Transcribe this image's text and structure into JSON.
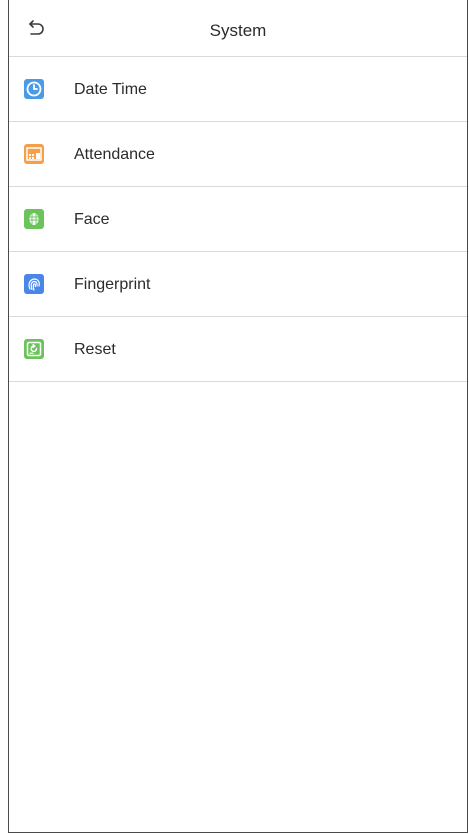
{
  "header": {
    "title": "System",
    "back_icon": "back-arrow-icon"
  },
  "menu": {
    "items": [
      {
        "label": "Date Time",
        "icon": "clock-icon",
        "color": "#4a9be6"
      },
      {
        "label": "Attendance",
        "icon": "attendance-icon",
        "color": "#f4a04a"
      },
      {
        "label": "Face",
        "icon": "face-icon",
        "color": "#6cc35c"
      },
      {
        "label": "Fingerprint",
        "icon": "fingerprint-icon",
        "color": "#4a86e8"
      },
      {
        "label": "Reset",
        "icon": "reset-icon",
        "color": "#6cc35c"
      }
    ]
  }
}
